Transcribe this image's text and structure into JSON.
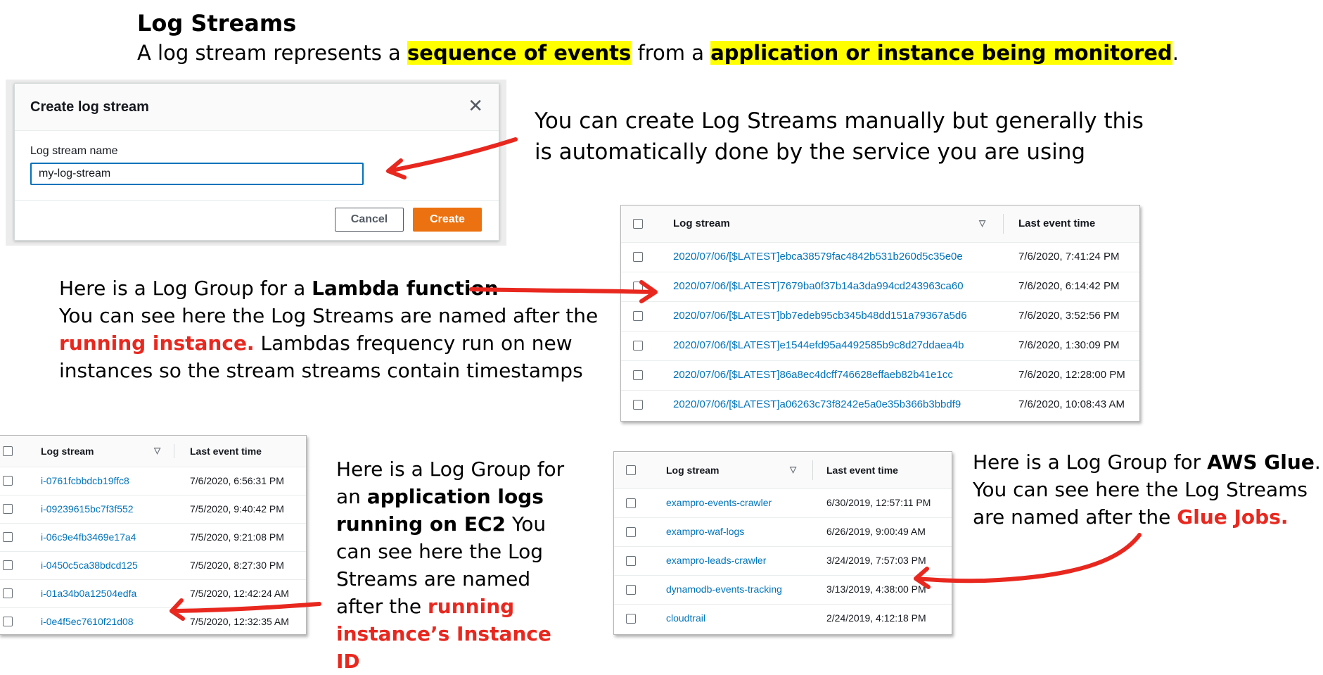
{
  "header": {
    "title": "Log Streams",
    "subtitle_pre": "A log stream represents a ",
    "subtitle_hl1": "sequence of events",
    "subtitle_mid": " from a ",
    "subtitle_hl2": "application or instance being monitored",
    "subtitle_post": "."
  },
  "dialog": {
    "title": "Create log stream",
    "close_icon": "close-icon",
    "field_label": "Log stream name",
    "field_value": "my-log-stream",
    "cancel_label": "Cancel",
    "create_label": "Create"
  },
  "notes": {
    "manual": "You can create Log Streams manually but generally this is automatically done by the service you are using",
    "lambda_pre": "Here is a Log Group for a ",
    "lambda_bold": "Lambda function",
    "lambda_line2": "You can see here the Log Streams are named after the",
    "lambda_red": "running instance.",
    "lambda_line3": " Lambdas frequency run on new instances so the stream streams contain timestamps",
    "ec2_pre": "Here is a Log Group for an ",
    "ec2_bold": "application logs running on EC2",
    "ec2_mid": " You can see here the Log Streams are named after the ",
    "ec2_red": "running instance’s Instance ID",
    "glue_pre": "Here is a Log Group for ",
    "glue_bold": "AWS Glue",
    "glue_mid": ". You can see here the Log Streams are named after the ",
    "glue_red": "Glue Jobs."
  },
  "lambda_table": {
    "col_stream": "Log stream",
    "col_time": "Last event time",
    "rows": [
      {
        "stream": "2020/07/06/[$LATEST]ebca38579fac4842b531b260d5c35e0e",
        "time": "7/6/2020, 7:41:24 PM"
      },
      {
        "stream": "2020/07/06/[$LATEST]7679ba0f37b14a3da994cd243963ca60",
        "time": "7/6/2020, 6:14:42 PM"
      },
      {
        "stream": "2020/07/06/[$LATEST]bb7edeb95cb345b48dd151a79367a5d6",
        "time": "7/6/2020, 3:52:56 PM"
      },
      {
        "stream": "2020/07/06/[$LATEST]e1544efd95a4492585b9c8d27ddaea4b",
        "time": "7/6/2020, 1:30:09 PM"
      },
      {
        "stream": "2020/07/06/[$LATEST]86a8ec4dcff746628effaeb82b41e1cc",
        "time": "7/6/2020, 12:28:00 PM"
      },
      {
        "stream": "2020/07/06/[$LATEST]a06263c73f8242e5a0e35b366b3bbdf9",
        "time": "7/6/2020, 10:08:43 AM"
      }
    ]
  },
  "ec2_table": {
    "col_stream": "Log stream",
    "col_time": "Last event time",
    "rows": [
      {
        "stream": "i-0761fcbbdcb19ffc8",
        "time": "7/6/2020, 6:56:31 PM"
      },
      {
        "stream": "i-09239615bc7f3f552",
        "time": "7/5/2020, 9:40:42 PM"
      },
      {
        "stream": "i-06c9e4fb3469e17a4",
        "time": "7/5/2020, 9:21:08 PM"
      },
      {
        "stream": "i-0450c5ca38bdcd125",
        "time": "7/5/2020, 8:27:30 PM"
      },
      {
        "stream": "i-01a34b0a12504edfa",
        "time": "7/5/2020, 12:42:24 AM"
      },
      {
        "stream": "i-0e4f5ec7610f21d08",
        "time": "7/5/2020, 12:32:35 AM"
      }
    ]
  },
  "glue_table": {
    "col_stream": "Log stream",
    "col_time": "Last event time",
    "rows": [
      {
        "stream": "exampro-events-crawler",
        "time": "6/30/2019, 12:57:11 PM"
      },
      {
        "stream": "exampro-waf-logs",
        "time": "6/26/2019, 9:00:49 AM"
      },
      {
        "stream": "exampro-leads-crawler",
        "time": "3/24/2019, 7:57:03 PM"
      },
      {
        "stream": "dynamodb-events-tracking",
        "time": "3/13/2019, 4:38:00 PM"
      },
      {
        "stream": "cloudtrail",
        "time": "2/24/2019, 4:12:18 PM"
      }
    ]
  },
  "colors": {
    "highlight": "#ffff00",
    "annotation_red": "#e8281f",
    "aws_link": "#0073bb",
    "aws_orange": "#ec7211"
  }
}
